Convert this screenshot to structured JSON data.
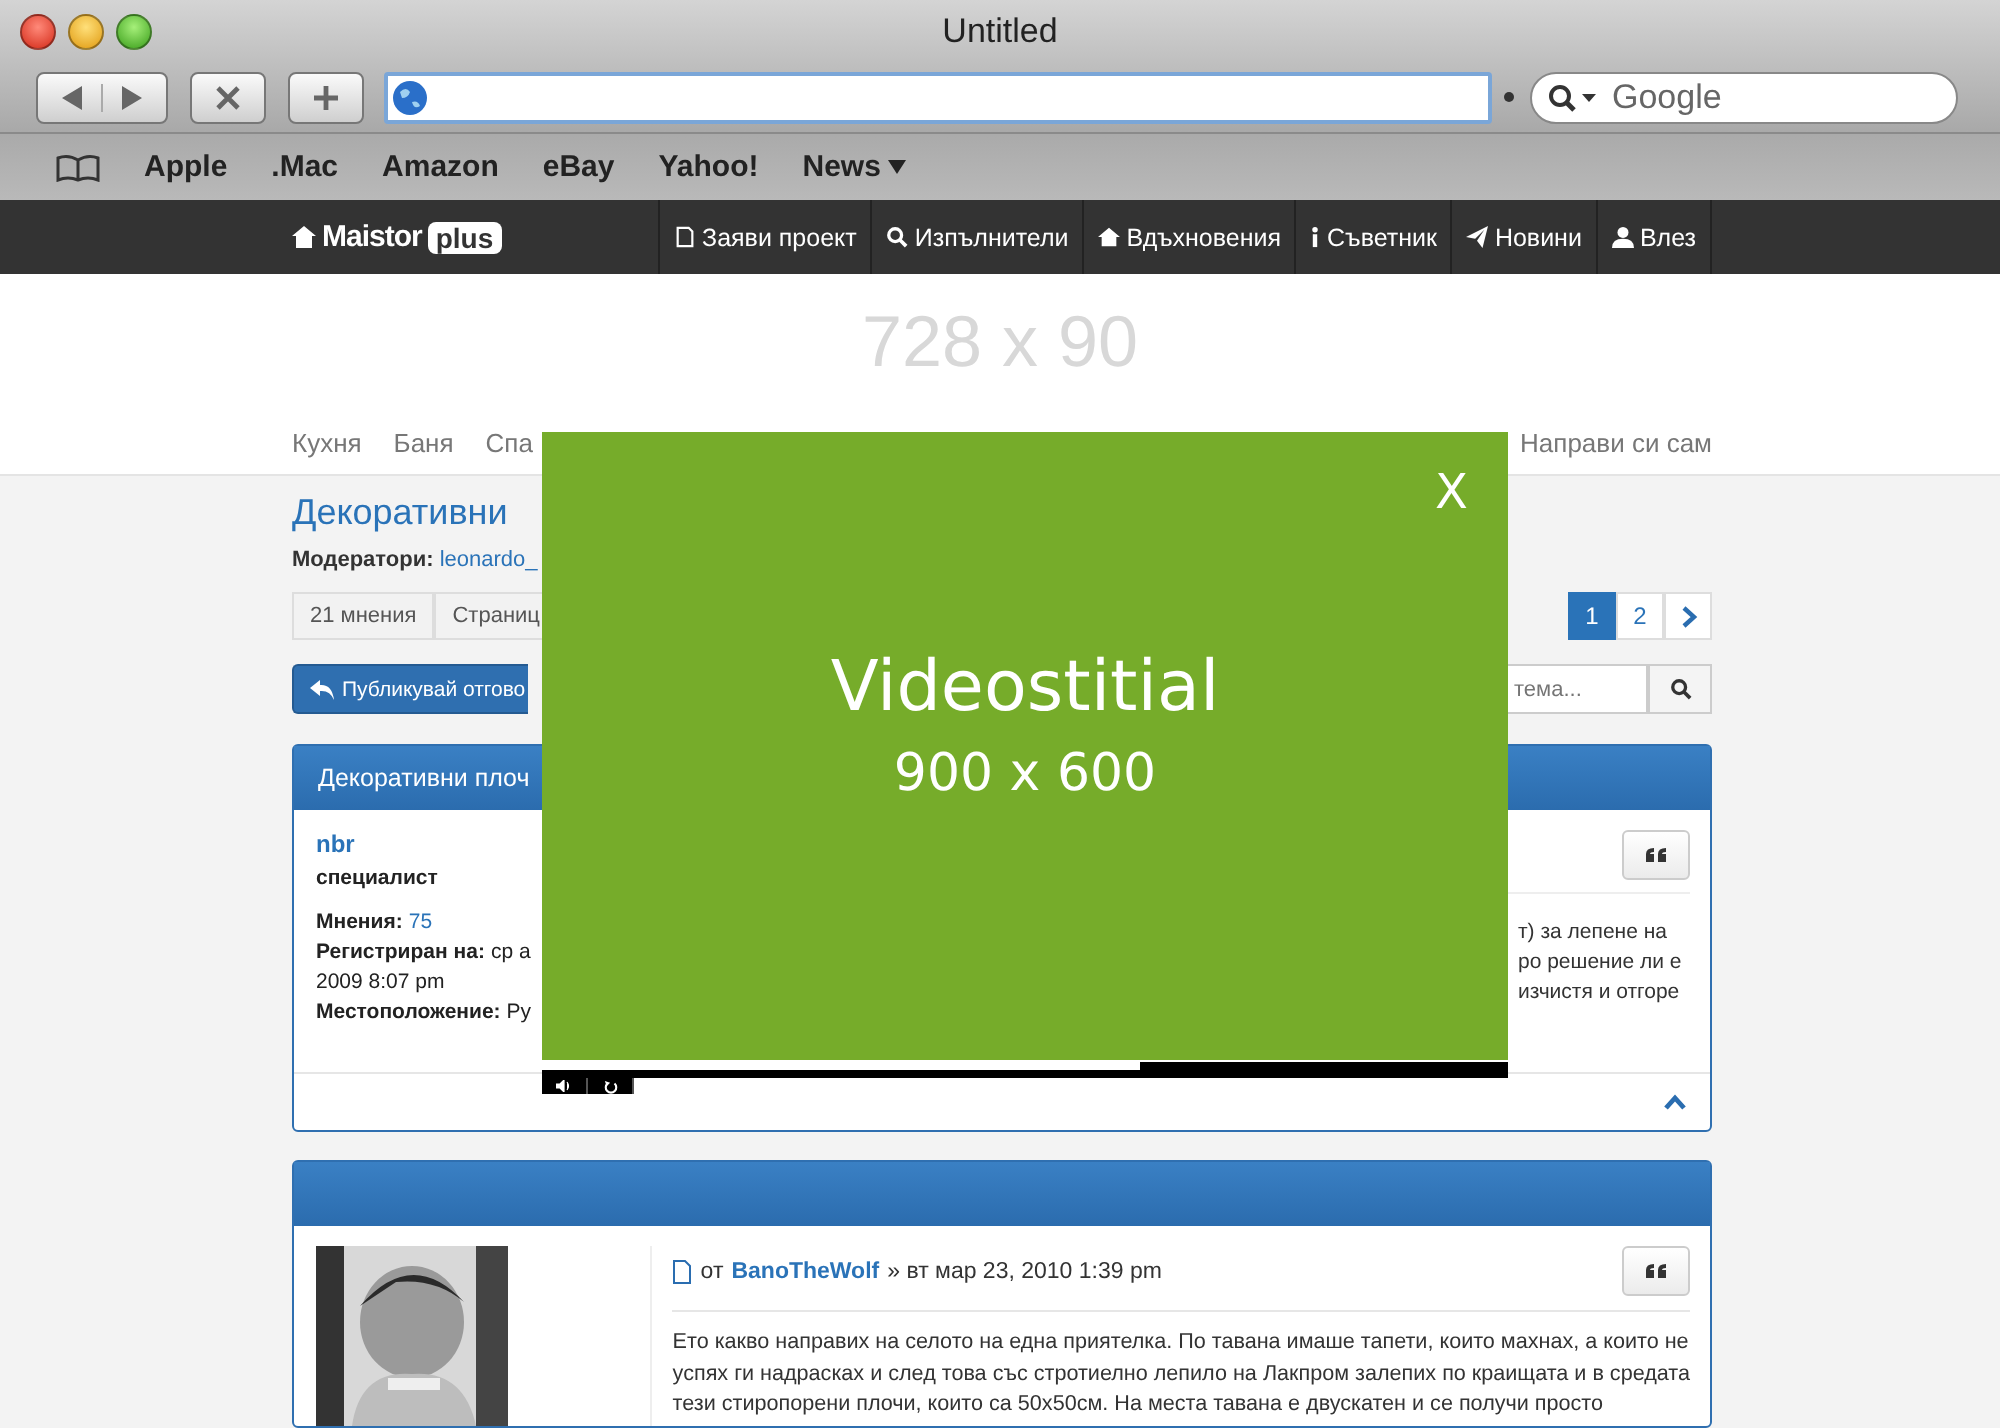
{
  "window": {
    "title": "Untitled"
  },
  "toolbar": {
    "search": {
      "placeholder": "Google"
    }
  },
  "bookmarks": [
    {
      "label": "Apple",
      "has_menu": false
    },
    {
      "label": ".Mac",
      "has_menu": false
    },
    {
      "label": "Amazon",
      "has_menu": false
    },
    {
      "label": "eBay",
      "has_menu": false
    },
    {
      "label": "Yahoo!",
      "has_menu": false
    },
    {
      "label": "News",
      "has_menu": true
    }
  ],
  "site_nav": {
    "logo": {
      "word": "Maistor",
      "badge": "plus"
    },
    "items": [
      {
        "kind": "file",
        "label": "Заяви проект"
      },
      {
        "kind": "search",
        "label": "Изпълнители"
      },
      {
        "kind": "home",
        "label": "Вдъхновения"
      },
      {
        "kind": "info",
        "label": "Съветник"
      },
      {
        "kind": "send",
        "label": "Новини"
      },
      {
        "kind": "user",
        "label": "Влез"
      }
    ]
  },
  "banner": {
    "text": "728 x 90"
  },
  "categories": {
    "left": [
      "Кухня",
      "Баня",
      "Спа"
    ],
    "right": [
      "Направи си сам"
    ]
  },
  "topic": {
    "title": "Декоративни",
    "moderators_label": "Модератори:",
    "moderator": "leonardo_",
    "posts_count": "21 мнения",
    "pages_label": "Страниц",
    "pages": [
      {
        "label": "1",
        "selected": true
      },
      {
        "label": "2",
        "selected": false
      }
    ],
    "reply_button": "Публикувай отгово",
    "search_placeholder": "тема..."
  },
  "post_1": {
    "header": "Декоративни плоч",
    "author": "nbr",
    "rank": "специалист",
    "details": [
      {
        "label": "Мнения:",
        "value": "75",
        "link": true
      },
      {
        "label": "Регистриран на:",
        "value": "ср а",
        "link": false
      },
      {
        "value": "2009 8:07 pm",
        "link": false
      },
      {
        "label": "Местоположение:",
        "value": "Ру",
        "link": false
      }
    ],
    "body_lines": [
      "т) за лепене на",
      "ро решение ли е",
      "изчистя и отгоре"
    ]
  },
  "post_2": {
    "author": "BanoTheWolf",
    "by": "от",
    "date": "» вт мар 23, 2010 1:39 pm",
    "body_lines": [
      "Ето какво направих на селото на една приятелка. По тавана имаше тапети, които махнах, а които не",
      "успях ги надрасках и след това със стротиелно лепило на Лакпром залепих по краищата и в средата",
      "тези стиропорени плочи, които са 50x50см. На места тавана е двускатен и се получи просто"
    ]
  },
  "overlay": {
    "title": "Videostitial",
    "size": "900 x 600",
    "close": "X",
    "progress": {
      "level": 0.62
    }
  }
}
